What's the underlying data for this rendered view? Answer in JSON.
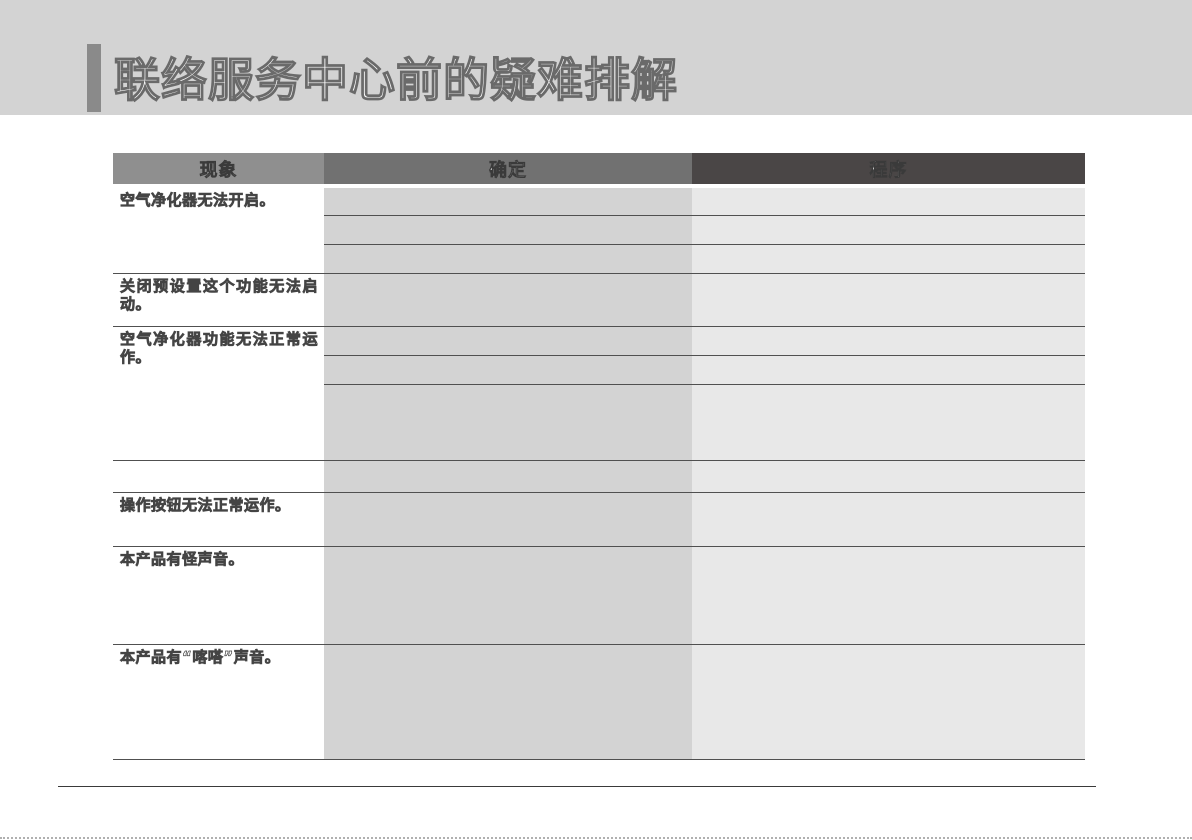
{
  "page": {
    "title": "联络服务中心前的疑难排解"
  },
  "table": {
    "headers": [
      "现象",
      "确定",
      "程序"
    ],
    "symptoms": [
      "空气净化器无法开启。",
      "关闭预设置这个功能无法启动。",
      "空气净化器功能无法正常运作。",
      "操作按钮无法正常运作。",
      "本产品有怪声音。",
      "本产品有“喀嗒”声音。"
    ]
  },
  "colors": {
    "header_band": "#d3d3d3",
    "header_col1": "#8f8f8f",
    "header_col2": "#717171",
    "header_col3": "#4a4646",
    "check_column": "#d3d3d3",
    "procedure_column": "#e8e8e8"
  }
}
